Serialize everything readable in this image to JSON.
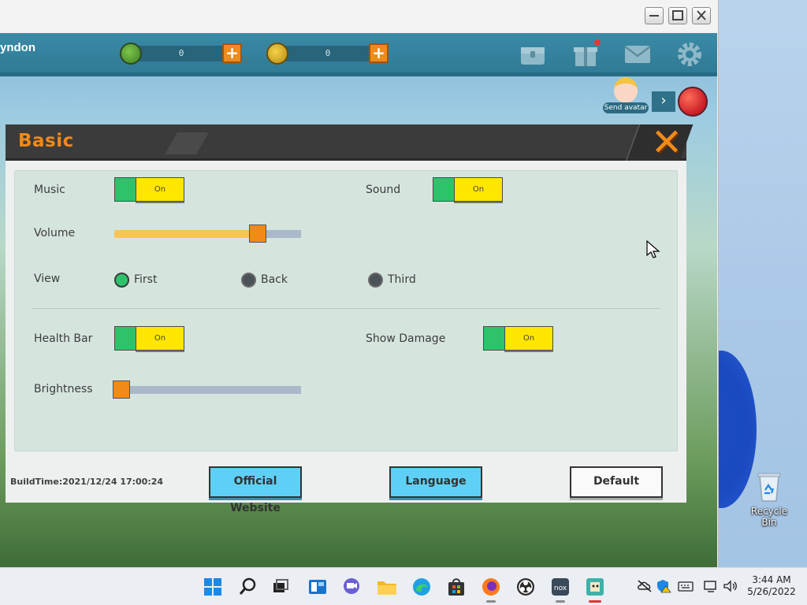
{
  "game_top": {
    "player_name": "yndon",
    "currency1_value": "0",
    "currency2_value": "0",
    "send_avatar_label": "Send avatar"
  },
  "dialog": {
    "title": "Basic",
    "music_label": "Music",
    "music_state": "On",
    "sound_label": "Sound",
    "sound_state": "On",
    "volume_label": "Volume",
    "volume_level": 0.77,
    "view_label": "View",
    "view_options": [
      "First",
      "Back",
      "Third"
    ],
    "view_selected": "First",
    "health_bar_label": "Health Bar",
    "health_bar_state": "On",
    "show_damage_label": "Show Damage",
    "show_damage_state": "On",
    "brightness_label": "Brightness",
    "brightness_level": 0.04,
    "build_time": "BuildTime:2021/12/24 17:00:24",
    "official_website_label": "Official Website",
    "language_label": "Language",
    "default_label": "Default"
  },
  "desktop": {
    "recycle_bin_label": "Recycle Bin"
  },
  "taskbar": {
    "apps": [
      "start-icon",
      "search-icon",
      "task-view-icon",
      "widgets-icon",
      "chat-icon",
      "file-explorer-icon",
      "edge-icon",
      "store-icon",
      "firefox-icon",
      "obs-icon",
      "nox-icon",
      "game-icon"
    ],
    "clock_time": "3:44 AM",
    "clock_date": "5/26/2022"
  },
  "colors": {
    "accent_orange": "#f08a18",
    "toggle_yellow": "#ffe600",
    "toggle_green": "#2ec36a",
    "button_blue": "#5fd0f5",
    "panel_green": "#d5e5de"
  }
}
